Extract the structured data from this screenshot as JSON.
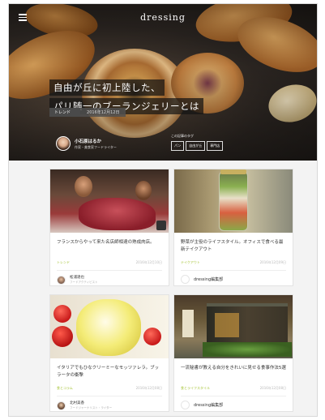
{
  "header": {
    "logo": "dressing"
  },
  "hero": {
    "title_line1": "自由が丘に初上陸した、",
    "title_line2": "パリ随一のブーランジェリーとは",
    "category": "トレンド",
    "date": "2016年12月12日",
    "author_name": "小石原はるか",
    "author_role": "作家・美食家フードライター",
    "tags_label": "この記事のタグ",
    "tags": [
      "パン",
      "自由が丘",
      "専門店"
    ]
  },
  "cards": [
    {
      "title": "フランスからやって来た名店師相達の熟成肉店。",
      "category": "トレンド",
      "date": "2016年12月10日",
      "author_name": "松浦達也",
      "author_role": "フードアクティビスト"
    },
    {
      "title": "野菜が主役のライフスタイル。オフィスで食べる最新テイクアウト",
      "category": "テイクアウト",
      "date": "2016年12月09日",
      "author_name": "dressing編集部",
      "author_role": ""
    },
    {
      "title": "イタリアでもひなクリーミーなモッツァレラ。ブッラータの衝撃",
      "category": "食とコラム",
      "date": "2016年12月08日",
      "author_name": "北村美香",
      "author_role": "フードジャーナリスト・ライター"
    },
    {
      "title": "一流秘書が教える自分をきれいに見せる食事作法5選",
      "category": "食とライフスタイル",
      "date": "2016年12月08日",
      "author_name": "dressing編集部",
      "author_role": ""
    }
  ],
  "colors": {
    "accent_category": "#a8c53a",
    "card_bg": "#ffffff",
    "page_bg": "#f3f3f3"
  }
}
